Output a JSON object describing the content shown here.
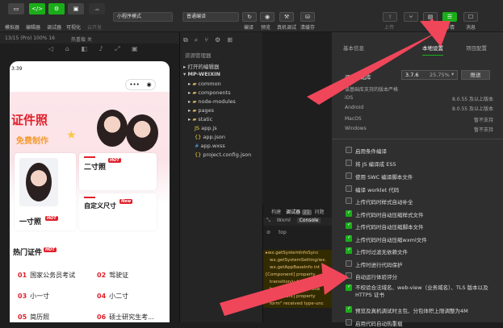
{
  "toolbar": {
    "labels": [
      "模拟器",
      "编辑器",
      "调试器",
      "可视化",
      "云开发"
    ],
    "mode_select": "小程序模式",
    "compile_select": "普通编译",
    "right_labels": [
      "编译",
      "预览",
      "真机调试",
      "清缓存"
    ],
    "far_right_labels": [
      "上传",
      "版本管理",
      "测试号",
      "详情",
      "消息"
    ],
    "colors": {
      "green": "#1aad19",
      "arrow": "#f0465a"
    }
  },
  "simulator": {
    "device": "13/15 (Pro) 100% 16",
    "hotreload": "热重载 关",
    "status_time": "3:39",
    "banner_title": "证件照",
    "banner_sub": "免费制作",
    "card1_label": "一寸照",
    "card2_label": "二寸照",
    "card3_label": "自定义尺寸",
    "hot_badge": "HOT",
    "new_badge": "New",
    "hot_section": "热门证件",
    "list": [
      {
        "num": "01",
        "name": "国家公务员考试",
        "num2": "02",
        "name2": "驾驶证"
      },
      {
        "num": "03",
        "name": "小一寸",
        "num2": "04",
        "name2": "小二寸"
      },
      {
        "num": "05",
        "name": "简历照",
        "num2": "06",
        "name2": "硕士研究生考..."
      }
    ]
  },
  "tree": {
    "header": "资源管理器",
    "open_editors": "打开的编辑器",
    "project": "MP-WEIXIN",
    "items": [
      "common",
      "components",
      "node-modules",
      "pages",
      "static",
      "app.js",
      "app.json",
      "app.wxss",
      "project.config.json"
    ]
  },
  "console": {
    "tabs": [
      "构建",
      "调试器",
      "21",
      "问题"
    ],
    "subtabs": [
      "Wxml",
      "Console"
    ],
    "filter": "top",
    "lines": [
      "▸wx.getSystemInfoSync",
      "wx.getSystemSetting/wx.",
      "wx.getAppBaseInfo int",
      "[Component] property",
      "transition/u-transitio",
      "but get null value. Use",
      "[Component] property",
      "form\" received type-unc"
    ]
  },
  "panel": {
    "tabs": [
      "基本信息",
      "项目配置",
      "本地设置",
      "项目配置"
    ],
    "tab_active": "本地设置",
    "lib_label": "调试基础库",
    "lib_version": "3.7.6",
    "lib_percent": "25.75%",
    "lib_button": "推送",
    "lib_note": "该基础库支持的版本严格",
    "platforms": [
      {
        "name": "iOS",
        "value": "8.0.55 及以上版本"
      },
      {
        "name": "Android",
        "value": "8.0.55 及以上版本"
      },
      {
        "name": "MacOS",
        "value": "暂不支持"
      },
      {
        "name": "Windows",
        "value": "暂不支持"
      }
    ],
    "settings": [
      {
        "label": "启用条件编译",
        "checked": false
      },
      {
        "label": "将 JS 编译成 ES5",
        "checked": false
      },
      {
        "label": "使用 SWC 编译脚本文件",
        "checked": false
      },
      {
        "label": "编译 worklet 代码",
        "checked": false
      },
      {
        "label": "上传代码时样式自动补全",
        "checked": false
      },
      {
        "label": "上传代码时自动压缩样式文件",
        "checked": true
      },
      {
        "label": "上传代码时自动压缩脚本文件",
        "checked": true
      },
      {
        "label": "上传代码时自动压缩wxml文件",
        "checked": true
      },
      {
        "label": "上传时过滤无依赖文件",
        "checked": true
      },
      {
        "label": "上传时进行代码保护",
        "checked": false
      },
      {
        "label": "自动运行体验评分",
        "checked": false
      },
      {
        "label": "不校验合法域名、web-view（业务域名）、TLS 版本以及 HTTPS 证书",
        "checked": true
      },
      {
        "label": "预览及真机调试时主包、分包体积上限调整为4M",
        "checked": true
      },
      {
        "label": "启用代码自动热重载",
        "checked": false
      }
    ]
  }
}
